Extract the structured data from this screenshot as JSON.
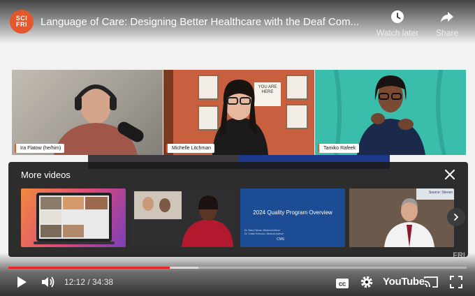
{
  "channel": {
    "logo_line1": "SCI",
    "logo_line2": "FRI"
  },
  "video": {
    "title": "Language of Care: Designing Better Healthcare with the Deaf Com...",
    "watch_later_label": "Watch later",
    "share_label": "Share"
  },
  "participants": [
    {
      "name": "Ira Flatow (he/him)"
    },
    {
      "name": "Michelle Litchman"
    },
    {
      "name": "Tamiko Rafeek"
    }
  ],
  "tile2_sign": "YOU ARE HERE",
  "more_videos": {
    "heading": "More videos",
    "thumbnails": [
      {
        "kind": "video-call-collage"
      },
      {
        "kind": "interpreter-clip"
      },
      {
        "kind": "slide",
        "title": "2024 Quality Program Overview",
        "sub_line1": "Dr. Mary Hanna, Medical Advisor",
        "sub_line2": "Dr. Kristin Ericsson, Medical Advisor",
        "footer_logo": "CMS"
      },
      {
        "kind": "talk",
        "corner_text": "Source: Steven"
      }
    ]
  },
  "player": {
    "current_time": "12:12",
    "duration": "34:38",
    "time_display": "12:12 / 34:38",
    "played_fraction": 0.3525,
    "buffered_fraction": 0.415,
    "brand_label": "YouTube",
    "watermark": "FRI"
  },
  "colors": {
    "progress_played": "#e8262a",
    "channel_brand": "#e2572b",
    "tile2_bg": "#c85f3e",
    "tile3_bg": "#3dbfae"
  },
  "icons": [
    "watch-later-icon",
    "share-icon",
    "close-icon",
    "chevron-right-icon",
    "play-icon",
    "volume-icon",
    "captions-icon",
    "settings-icon",
    "cast-icon",
    "fullscreen-icon"
  ]
}
